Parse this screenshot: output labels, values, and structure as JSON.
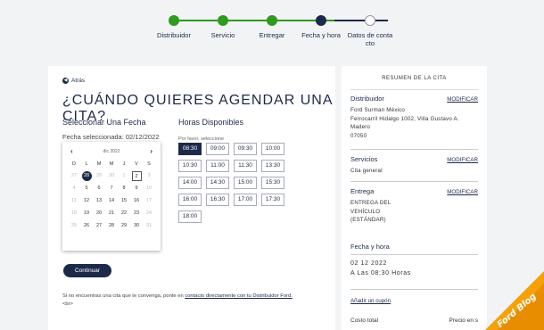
{
  "stepper": {
    "steps": [
      {
        "label": "Distribuidor",
        "state": "done"
      },
      {
        "label": "Servicio",
        "state": "done"
      },
      {
        "label": "Entregar",
        "state": "done"
      },
      {
        "label": "Fecha y hora",
        "state": "current"
      },
      {
        "label": "Datos de conta cto",
        "state": "pending"
      }
    ],
    "colors": {
      "done": "#2e9a1e",
      "current": "#1c2a4a",
      "pending": "#ffffff"
    }
  },
  "main": {
    "back_label": "Atrás",
    "title": "¿CUÁNDO QUIERES AGENDAR UNA CITA?",
    "date_heading": "Seleccionar Una Fecha",
    "selected_date": "Fecha seleccionada: 02/12/2022",
    "hours_heading": "Horas Disponibles",
    "hours_hint": "Por favor, seleccione",
    "calendar": {
      "month": "dic 2022",
      "prev_icon": "chevron-left-icon",
      "next_icon": "chevron-right-icon",
      "weekdays": [
        "D",
        "L",
        "M",
        "M",
        "J",
        "V",
        "S"
      ],
      "days": [
        {
          "d": "27",
          "dim": true
        },
        {
          "d": "28",
          "dim": false,
          "sel": true
        },
        {
          "d": "29",
          "dim": true
        },
        {
          "d": "30",
          "dim": true
        },
        {
          "d": "1",
          "dim": true
        },
        {
          "d": "2",
          "box": true
        },
        {
          "d": "3",
          "dim": true
        },
        {
          "d": "4",
          "dim": true
        },
        {
          "d": "5"
        },
        {
          "d": "6"
        },
        {
          "d": "7"
        },
        {
          "d": "8"
        },
        {
          "d": "9"
        },
        {
          "d": "10",
          "dim": true
        },
        {
          "d": "11",
          "dim": true
        },
        {
          "d": "12"
        },
        {
          "d": "13"
        },
        {
          "d": "14"
        },
        {
          "d": "15"
        },
        {
          "d": "16"
        },
        {
          "d": "17",
          "dim": true
        },
        {
          "d": "18",
          "dim": true
        },
        {
          "d": "19"
        },
        {
          "d": "20"
        },
        {
          "d": "21"
        },
        {
          "d": "22"
        },
        {
          "d": "23"
        },
        {
          "d": "24",
          "dim": true
        },
        {
          "d": "25",
          "dim": true
        },
        {
          "d": "26"
        },
        {
          "d": "27"
        },
        {
          "d": "28"
        },
        {
          "d": "29"
        },
        {
          "d": "30"
        },
        {
          "d": "31",
          "dim": true
        }
      ]
    },
    "hours": [
      "08:30",
      "09:00",
      "09:30",
      "10:00",
      "10:30",
      "11:00",
      "11:30",
      "13:30",
      "14:00",
      "14:30",
      "15:00",
      "15:30",
      "16:00",
      "16:30",
      "17:00",
      "17:30",
      "18:00"
    ],
    "selected_hour": "08:30",
    "continue_label": "Continuar",
    "note_text": "Si no encuentras una cita que te convenga, ponte en",
    "note_link": "contacto directamente con tu Distribuidor Ford.",
    "note_tail": "<br>"
  },
  "summary": {
    "header": "RESUMEN DE LA CITA",
    "distribuidor_title": "Distribuidor",
    "distribuidor_lines": [
      "Ford Surman México",
      "Ferrocarril Hidalgo 1002, Villa Gustavo A.",
      "Madero",
      "07050"
    ],
    "servicios_title": "Servicios",
    "servicios_value": "Cita general",
    "entrega_title": "Entrega",
    "entrega_lines": [
      "ENTREGA DEL",
      "VEHÍCULO",
      "(ESTÁNDAR)"
    ],
    "fecha_title": "Fecha y hora",
    "fecha_lines": [
      "02 12 2022",
      "A Las 08:30 Horas"
    ],
    "modify_label": "MODIFICAR",
    "coupon_label": "Añadir un cupón",
    "cost_label": "Costo total",
    "price_label": "Precio en s"
  },
  "badge": {
    "text": "Ford Blog",
    "color": "#f5a10a"
  }
}
